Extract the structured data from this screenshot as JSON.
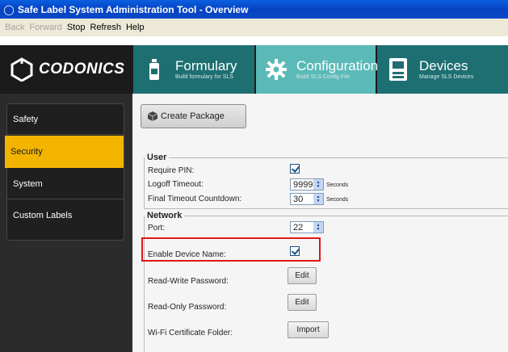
{
  "window": {
    "title": "Safe Label System Administration Tool - Overview"
  },
  "menu": {
    "back": "Back",
    "forward": "Forward",
    "stop": "Stop",
    "refresh": "Refresh",
    "help": "Help"
  },
  "logo": {
    "name": "CODONICS",
    "icon": "codonics-logo-icon"
  },
  "tabs": [
    {
      "title": "Formulary",
      "subtitle": "Build formulary for SLS",
      "icon": "bottle-icon"
    },
    {
      "title": "Configuration",
      "subtitle": "Build SLS Config File",
      "icon": "gear-icon"
    },
    {
      "title": "Devices",
      "subtitle": "Manage SLS Devices",
      "icon": "device-icon"
    }
  ],
  "sidebar": {
    "items": [
      {
        "label": "Safety"
      },
      {
        "label": "Security"
      },
      {
        "label": "System"
      },
      {
        "label": "Custom Labels"
      }
    ],
    "active_color": "#f3b400"
  },
  "main": {
    "create_package": "Create Package",
    "user": {
      "legend": "User",
      "require_pin_label": "Require PIN:",
      "require_pin_checked": true,
      "logoff_label": "Logoff Timeout:",
      "logoff_value": "9999",
      "logoff_unit": "Seconds",
      "final_label": "Final Timeout Countdown:",
      "final_value": "30",
      "final_unit": "Seconds"
    },
    "network": {
      "legend": "Network",
      "port_label": "Port:",
      "port_value": "22",
      "device_name_label": "Enable Device Name:",
      "device_name_checked": true,
      "rw_label": "Read-Write Password:",
      "rw_button": "Edit",
      "ro_label": "Read-Only Password:",
      "ro_button": "Edit",
      "wifi_label": "Wi-Fi Certificate Folder:",
      "wifi_button": "Import"
    }
  },
  "colors": {
    "highlight": "#e01818",
    "header_teal": "#1e6f72",
    "active_tab": "#5bbab8"
  }
}
